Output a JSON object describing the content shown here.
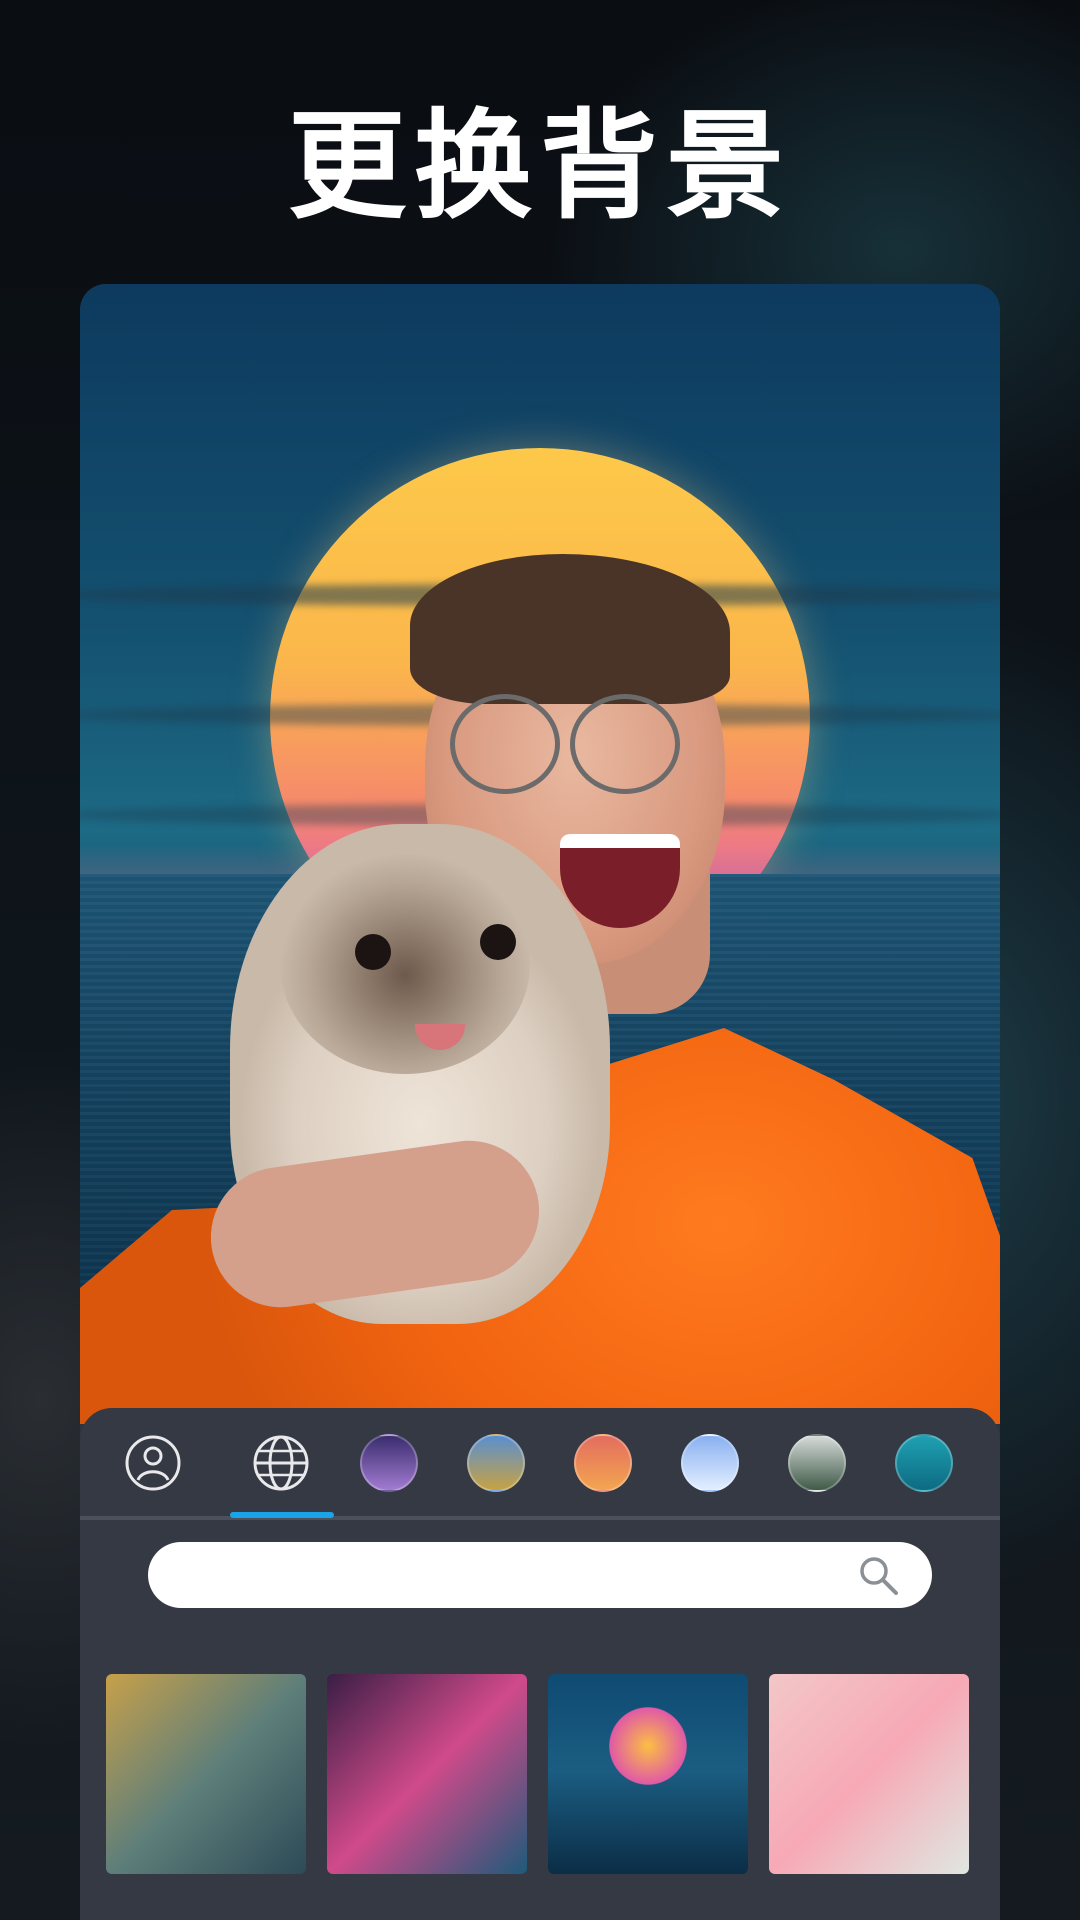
{
  "headline": "更换背景",
  "search": {
    "placeholder": "",
    "value": ""
  },
  "tabs": [
    {
      "name": "person-icon",
      "kind": "icon",
      "active": false
    },
    {
      "name": "globe-icon",
      "kind": "icon",
      "active": true
    },
    {
      "name": "purple-sky",
      "kind": "thumbnail",
      "colors": [
        "#3a2d6e",
        "#a27bd1"
      ]
    },
    {
      "name": "landscape-sky",
      "kind": "thumbnail",
      "colors": [
        "#5b8fcf",
        "#c7a243"
      ]
    },
    {
      "name": "sunset-sea",
      "kind": "thumbnail",
      "colors": [
        "#e36d5f",
        "#f3a550"
      ]
    },
    {
      "name": "crystal",
      "kind": "thumbnail",
      "colors": [
        "#8ab0f0",
        "#e3efff"
      ]
    },
    {
      "name": "foggy-forest",
      "kind": "thumbnail",
      "colors": [
        "#d6dbd9",
        "#3f5a48"
      ]
    },
    {
      "name": "teal-stars",
      "kind": "thumbnail",
      "colors": [
        "#1fa0b2",
        "#0d6b82"
      ]
    }
  ],
  "backgrounds": [
    {
      "name": "gold-marble",
      "colors": [
        "#c7a04a",
        "#5f7f7a",
        "#2d4a57"
      ]
    },
    {
      "name": "neon-leaves",
      "colors": [
        "#3a1e45",
        "#d04a8a",
        "#1e5a7a"
      ]
    },
    {
      "name": "sun-over-sea",
      "colors": [
        "#0f4a72",
        "#fcbf43",
        "#e05aa5"
      ]
    },
    {
      "name": "pink-clouds",
      "colors": [
        "#f2c7c8",
        "#f7a9b6",
        "#dfe7e1"
      ]
    }
  ],
  "theme": {
    "accent": "#1aa3e8",
    "panel": "#343944",
    "hoodie": "#f26410"
  }
}
